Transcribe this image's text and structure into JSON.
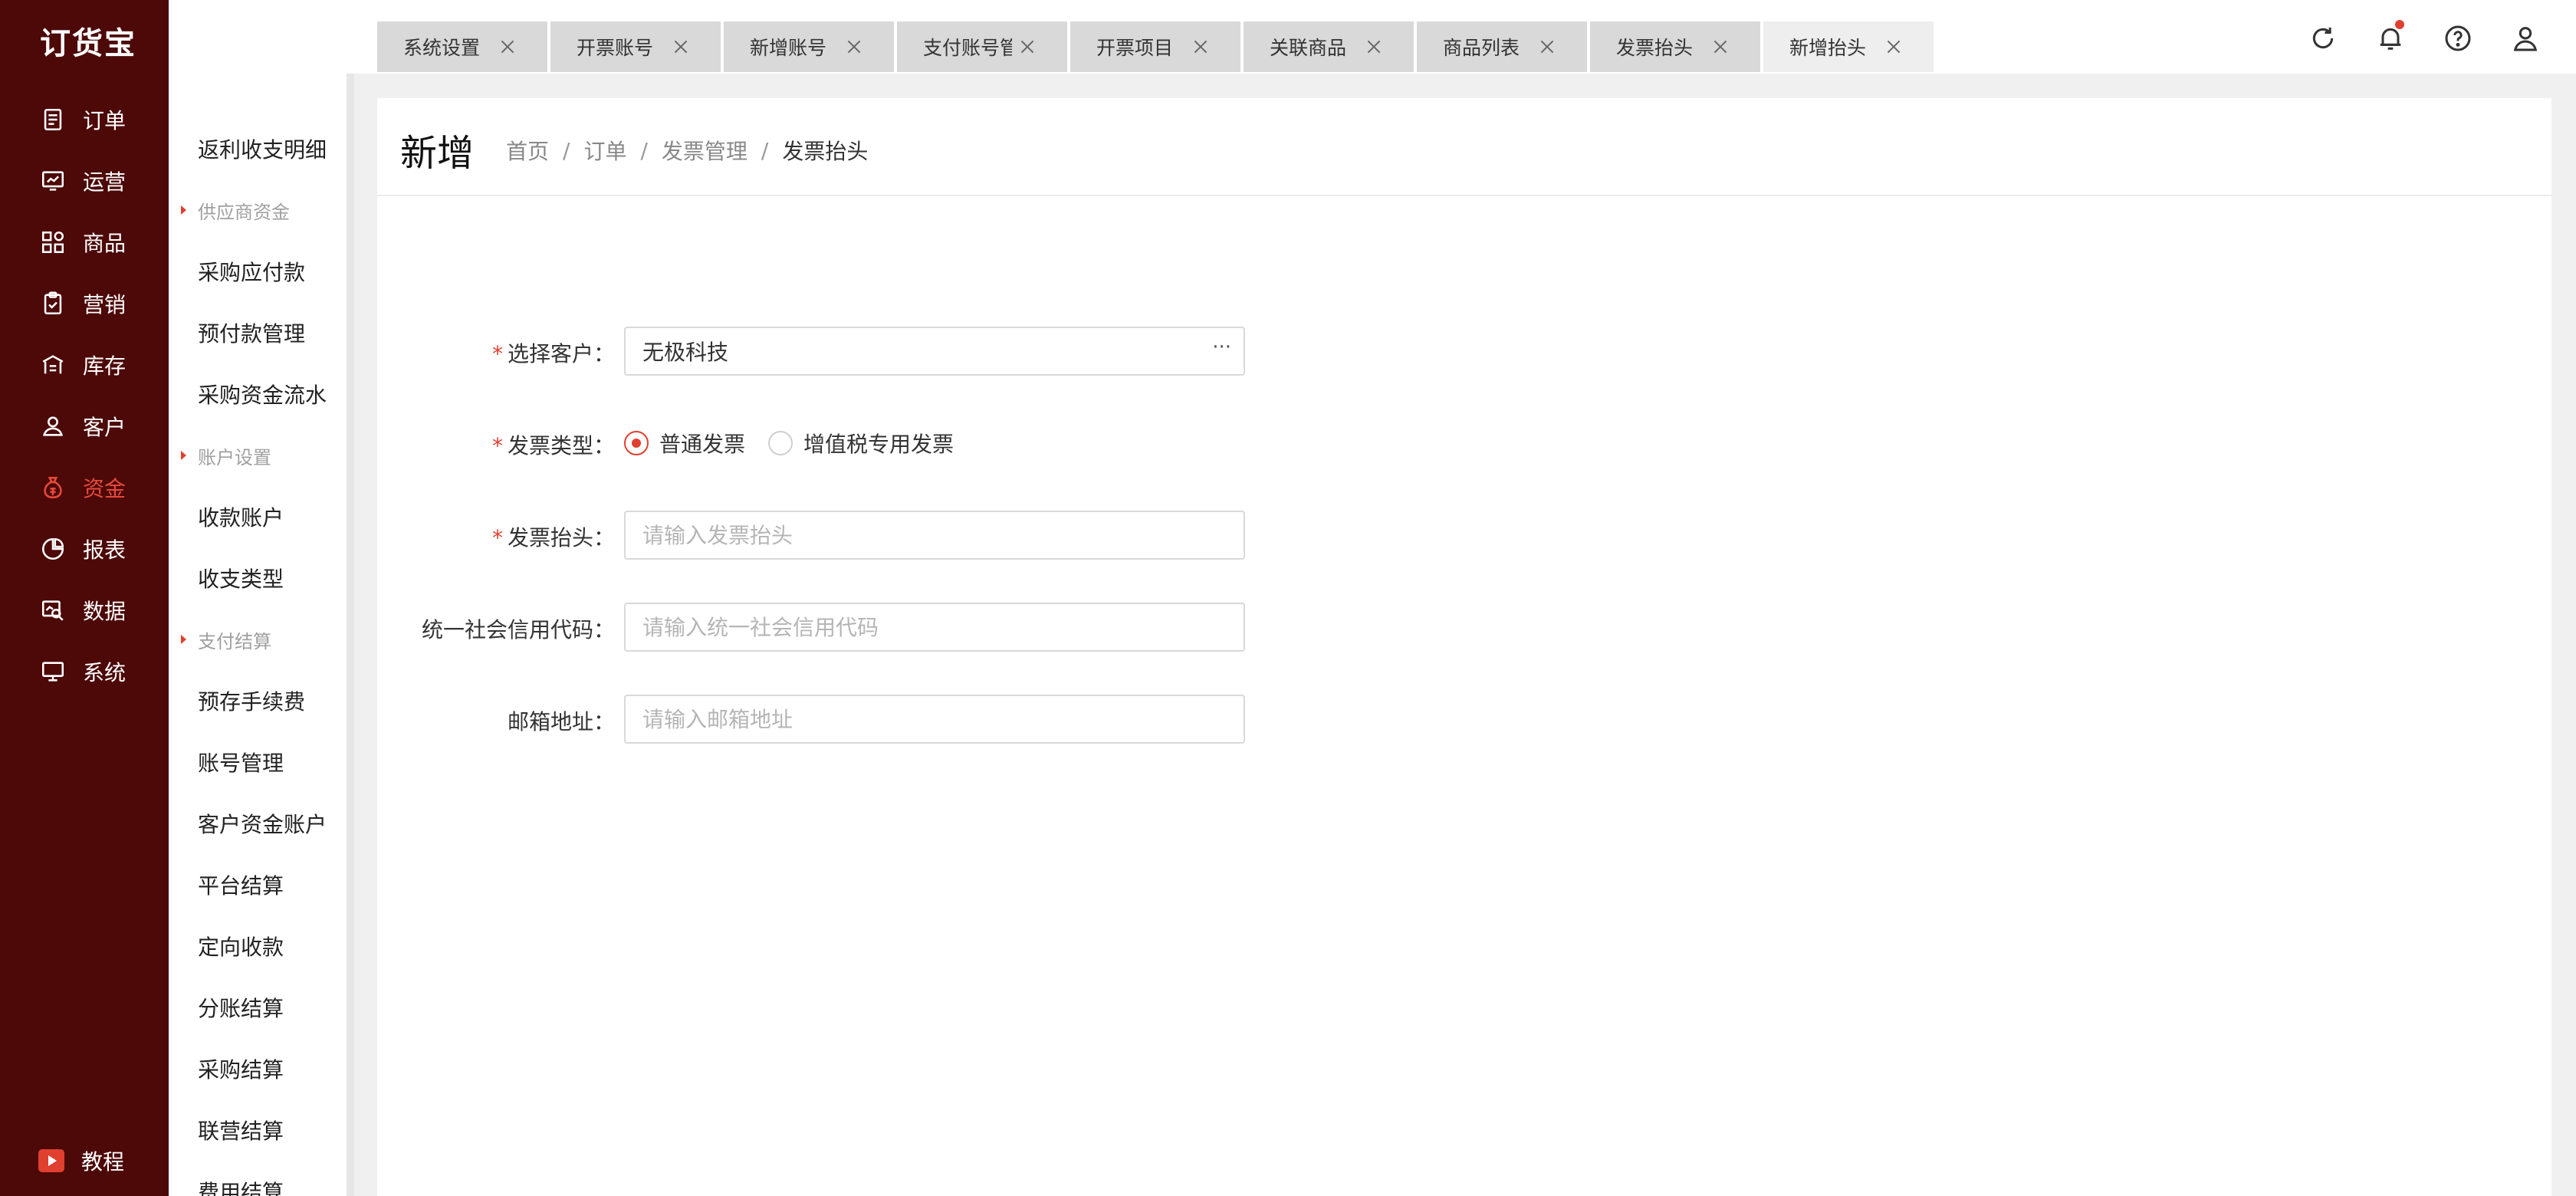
{
  "app": {
    "logo": "订货宝"
  },
  "primary_nav": {
    "items": [
      {
        "label": "订单",
        "icon": "order-icon"
      },
      {
        "label": "运营",
        "icon": "operation-icon"
      },
      {
        "label": "商品",
        "icon": "product-icon"
      },
      {
        "label": "营销",
        "icon": "marketing-icon"
      },
      {
        "label": "库存",
        "icon": "warehouse-icon"
      },
      {
        "label": "客户",
        "icon": "customer-icon"
      },
      {
        "label": "资金",
        "icon": "money-bag-icon",
        "active": true
      },
      {
        "label": "报表",
        "icon": "pie-chart-icon"
      },
      {
        "label": "数据",
        "icon": "data-icon"
      },
      {
        "label": "系统",
        "icon": "monitor-icon"
      }
    ],
    "bottom": {
      "label": "教程",
      "icon": "tutorial-play-icon"
    }
  },
  "tabs": [
    {
      "label": "系统设置"
    },
    {
      "label": "开票账号"
    },
    {
      "label": "新增账号"
    },
    {
      "label": "支付账号管理"
    },
    {
      "label": "开票项目"
    },
    {
      "label": "关联商品"
    },
    {
      "label": "商品列表"
    },
    {
      "label": "发票抬头"
    },
    {
      "label": "新增抬头",
      "active": true
    }
  ],
  "top_icons": [
    "refresh-icon",
    "bell-icon",
    "help-icon",
    "user-icon"
  ],
  "sub_nav": {
    "items": [
      {
        "type": "item",
        "label": "返利收支明细"
      },
      {
        "type": "group",
        "label": "供应商资金"
      },
      {
        "type": "item",
        "label": "采购应付款"
      },
      {
        "type": "item",
        "label": "预付款管理"
      },
      {
        "type": "item",
        "label": "采购资金流水"
      },
      {
        "type": "group",
        "label": "账户设置"
      },
      {
        "type": "item",
        "label": "收款账户"
      },
      {
        "type": "item",
        "label": "收支类型"
      },
      {
        "type": "group",
        "label": "支付结算"
      },
      {
        "type": "item",
        "label": "预存手续费"
      },
      {
        "type": "item",
        "label": "账号管理"
      },
      {
        "type": "item",
        "label": "客户资金账户"
      },
      {
        "type": "item",
        "label": "平台结算"
      },
      {
        "type": "item",
        "label": "定向收款"
      },
      {
        "type": "item",
        "label": "分账结算"
      },
      {
        "type": "item",
        "label": "采购结算"
      },
      {
        "type": "item",
        "label": "联营结算"
      },
      {
        "type": "item",
        "label": "费用结算"
      }
    ]
  },
  "page": {
    "title": "新增",
    "breadcrumb": [
      "首页",
      "订单",
      "发票管理",
      "发票抬头"
    ]
  },
  "form": {
    "customer": {
      "label": "选择客户：",
      "required": true,
      "value": "无极科技",
      "more": "···"
    },
    "invoice_type": {
      "label": "发票类型：",
      "required": true,
      "options": [
        {
          "label": "普通发票",
          "checked": true
        },
        {
          "label": "增值税专用发票",
          "checked": false
        }
      ]
    },
    "invoice_title": {
      "label": "发票抬头：",
      "required": true,
      "value": "",
      "placeholder": "请输入发票抬头"
    },
    "credit_code": {
      "label": "统一社会信用代码：",
      "required": false,
      "value": "",
      "placeholder": "请输入统一社会信用代码"
    },
    "email": {
      "label": "邮箱地址：",
      "required": false,
      "value": "",
      "placeholder": "请输入邮箱地址"
    }
  },
  "colors": {
    "sidebar_bg": "#4d0808",
    "accent": "#e0402f",
    "tab_bg": "#d9d9d9",
    "tab_active_bg": "#eeeeee"
  }
}
